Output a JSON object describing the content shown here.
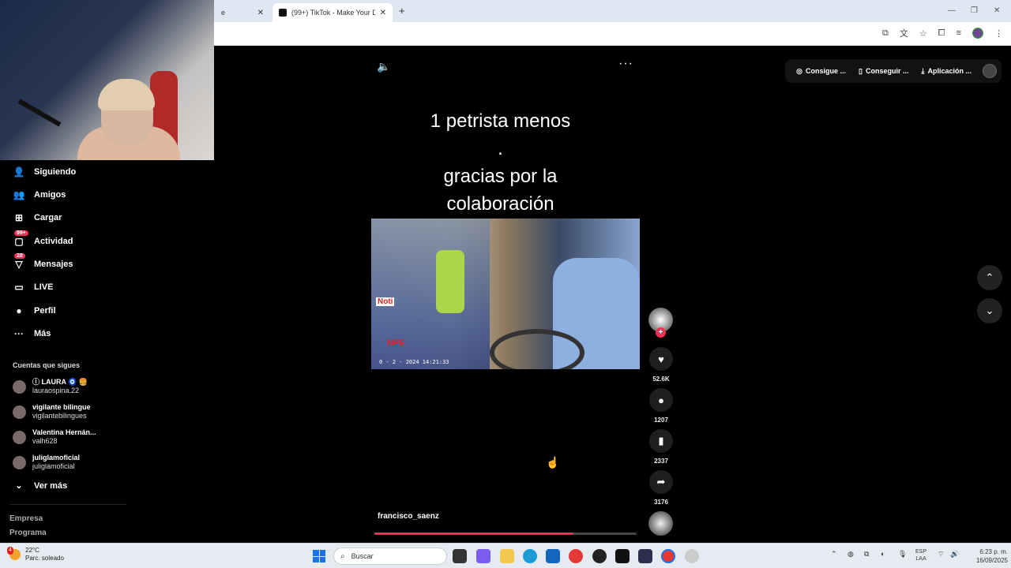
{
  "browser": {
    "tabs": [
      {
        "title": "e",
        "active": false
      },
      {
        "title": "(99+) TikTok - Make Your D…",
        "active": true
      }
    ],
    "new_tab": "+",
    "window_controls": [
      "—",
      "❐",
      "✕"
    ]
  },
  "sidebar": {
    "items": [
      {
        "label": "Siguiendo",
        "icon": "following-icon",
        "badge": ""
      },
      {
        "label": "Amigos",
        "icon": "friends-icon",
        "badge": ""
      },
      {
        "label": "Cargar",
        "icon": "upload-icon",
        "badge": ""
      },
      {
        "label": "Actividad",
        "icon": "activity-icon",
        "badge": "99+"
      },
      {
        "label": "Mensajes",
        "icon": "messages-icon",
        "badge": "28"
      },
      {
        "label": "LIVE",
        "icon": "live-icon",
        "badge": ""
      },
      {
        "label": "Perfil",
        "icon": "profile-icon",
        "badge": ""
      },
      {
        "label": "Más",
        "icon": "more-icon",
        "badge": ""
      }
    ],
    "following_title": "Cuentas que sigues",
    "following": [
      {
        "name": "ⓘ LAURA 🧿 🍔",
        "handle": "lauraospina.22"
      },
      {
        "name": "vigilante bilingue",
        "handle": "vigilantebilingues"
      },
      {
        "name": "Valentina Hernán...",
        "handle": "valh628"
      },
      {
        "name": "juliglamoficial",
        "handle": "juliglamoficial"
      }
    ],
    "see_more": "Ver más",
    "footer": [
      "Empresa",
      "Programa"
    ]
  },
  "topbar": {
    "pills": [
      {
        "label": "Consigue ...",
        "icon": "coin-icon"
      },
      {
        "label": "Conseguir ...",
        "icon": "phone-icon"
      },
      {
        "label": "Aplicación ...",
        "icon": "download-icon"
      }
    ]
  },
  "video": {
    "caption_lines": [
      "1 petrista menos",
      ".",
      "gracias por la",
      "colaboración"
    ],
    "timestamp": "0 - 2 - 2024 14:21:33",
    "overlay_logo": "Noti",
    "overlay_logo2": "NPE",
    "author": "francisco_saenz",
    "progress": 0.76
  },
  "actions": {
    "likes": "52.6K",
    "comments": "1207",
    "saves": "2337",
    "shares": "3176",
    "follow_plus": "+"
  },
  "taskbar": {
    "weather_temp": "22°C",
    "weather_desc": "Parc. soleado",
    "weather_badge": "4",
    "search_placeholder": "Buscar",
    "lang_line1": "ESP",
    "lang_line2": "LAA",
    "time": "6:23 p. m.",
    "date": "16/09/2025"
  }
}
